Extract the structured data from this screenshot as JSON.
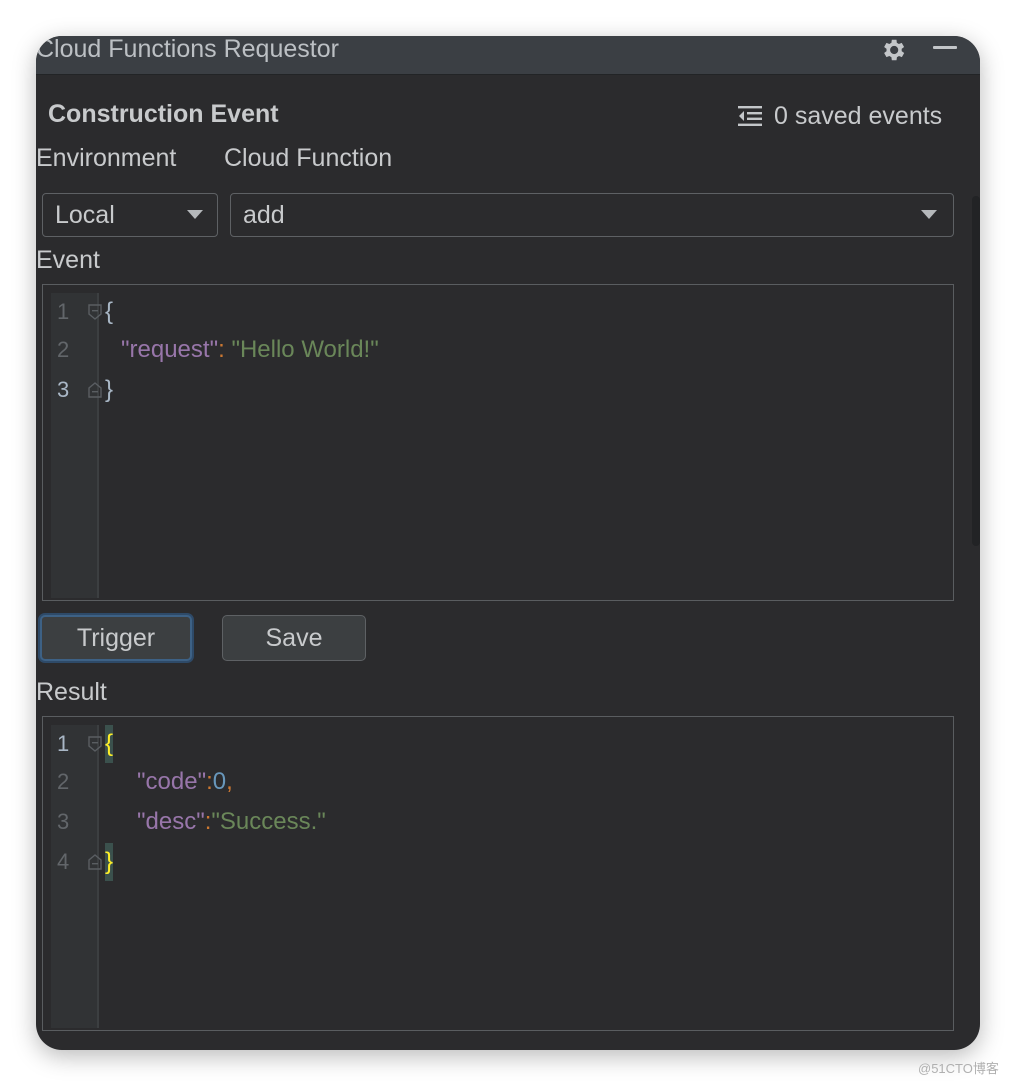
{
  "window": {
    "title": "Cloud Functions Requestor"
  },
  "panel": {
    "heading": "Construction Event",
    "saved_events": "0 saved events",
    "icons": {
      "settings": "gear-icon",
      "minimize": "minimize-icon",
      "saved": "list-icon"
    }
  },
  "form": {
    "environment_label": "Environment",
    "environment_value": "Local",
    "function_label": "Cloud Function",
    "function_value": "add",
    "event_label": "Event",
    "result_label": "Result"
  },
  "event_editor": {
    "lines": [
      {
        "num": "1",
        "text": "{"
      },
      {
        "num": "2",
        "key": "\"request\"",
        "sep": ": ",
        "value": "\"Hello World!\""
      },
      {
        "num": "3",
        "text": "}"
      }
    ]
  },
  "buttons": {
    "trigger": "Trigger",
    "save": "Save"
  },
  "result_editor": {
    "lines": [
      {
        "num": "1",
        "text": "{"
      },
      {
        "num": "2",
        "key": "\"code\"",
        "sep": ":",
        "value": "0",
        "comma": ","
      },
      {
        "num": "3",
        "key": "\"desc\"",
        "sep": ":",
        "value": "\"Success.\""
      },
      {
        "num": "4",
        "text": "}"
      }
    ]
  },
  "watermark": "@51CTO博客",
  "colors": {
    "background": "#2b2b2d",
    "key": "#9876aa",
    "string": "#6a8759",
    "number": "#6897bb",
    "punctuation": "#cc7832",
    "brace_highlight": "#ffef28",
    "focus_border": "#3d6185"
  }
}
